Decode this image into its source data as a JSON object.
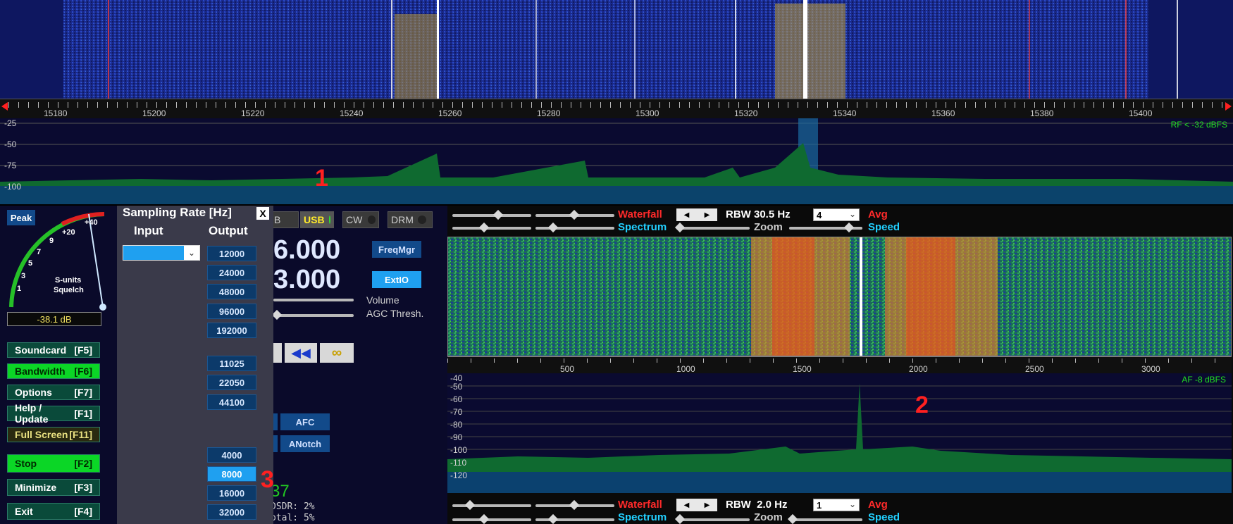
{
  "top_ruler": {
    "ticks": [
      "15180",
      "15200",
      "15220",
      "15240",
      "15260",
      "15280",
      "15300",
      "15320",
      "15340",
      "15360",
      "15380",
      "15400"
    ]
  },
  "rf_spectrum": {
    "db_labels": [
      "-25",
      "-50",
      "-75",
      "-100"
    ],
    "rf_label": "RF < -32 dBFS"
  },
  "annotations": {
    "one": "1",
    "two": "2",
    "three": "3"
  },
  "smeter": {
    "peak_label": "Peak",
    "scale_labels": [
      "+40",
      "+20",
      "9",
      "7",
      "5",
      "3",
      "1"
    ],
    "caption1": "S-units",
    "caption2": "Squelch",
    "readout": "-38.1 dB"
  },
  "left_buttons": [
    {
      "label": "Soundcard",
      "key": "[F5]"
    },
    {
      "label": "Bandwidth",
      "key": "[F6]"
    },
    {
      "label": "Options",
      "key": "[F7]"
    },
    {
      "label": "Help / Update",
      "key": "[F1]"
    },
    {
      "label": "Full Screen",
      "key": "[F11]"
    },
    {
      "label": "Stop",
      "key": "[F2]"
    },
    {
      "label": "Minimize",
      "key": "[F3]"
    },
    {
      "label": "Exit",
      "key": "[F4]"
    }
  ],
  "sampling_popup": {
    "title": "Sampling Rate [Hz]",
    "close": "X",
    "input_header": "Input",
    "output_header": "Output",
    "group1": [
      "12000",
      "24000",
      "48000",
      "96000",
      "192000"
    ],
    "group2": [
      "11025",
      "22050",
      "44100"
    ],
    "group3": [
      "4000",
      "8000",
      "16000",
      "32000"
    ],
    "selected": "8000"
  },
  "modes": [
    "B",
    "USB",
    "CW",
    "DRM"
  ],
  "freq": {
    "line1": "6.000",
    "line2": "3.000"
  },
  "buttons": {
    "freqmgr": "FreqMgr",
    "extio": "ExtIO",
    "afc": "AFC",
    "anotch": "ANotch"
  },
  "slider_labels": {
    "volume": "Volume",
    "agc": "AGC Thresh."
  },
  "status": {
    "big_num": "37",
    "line1": "DSDR: 2%",
    "line2": "otal: 5%"
  },
  "rf_controls": {
    "waterfall": "Waterfall",
    "rbw": "RBW 30.5 Hz",
    "avg_value": "4",
    "avg": "Avg",
    "spectrum": "Spectrum",
    "zoom": "Zoom",
    "speed": "Speed"
  },
  "af_ruler": {
    "ticks": [
      "500",
      "1000",
      "1500",
      "2000",
      "2500",
      "3000"
    ]
  },
  "af_spectrum": {
    "db_labels": [
      "-40",
      "-50",
      "-60",
      "-70",
      "-80",
      "-90",
      "-100",
      "-110",
      "-120"
    ],
    "af_label": "AF -8 dBFS"
  },
  "af_controls": {
    "waterfall": "Waterfall",
    "rbw": "RBW  2.0 Hz",
    "avg_value": "1",
    "avg": "Avg",
    "spectrum": "Spectrum",
    "zoom": "Zoom",
    "speed": "Speed"
  },
  "colors": {
    "waterfall_blue": "#1a2a8c",
    "panel_bg": "#0a0a2a",
    "green_btn": "#0bd626",
    "accent_blue": "#1fa0f0"
  }
}
